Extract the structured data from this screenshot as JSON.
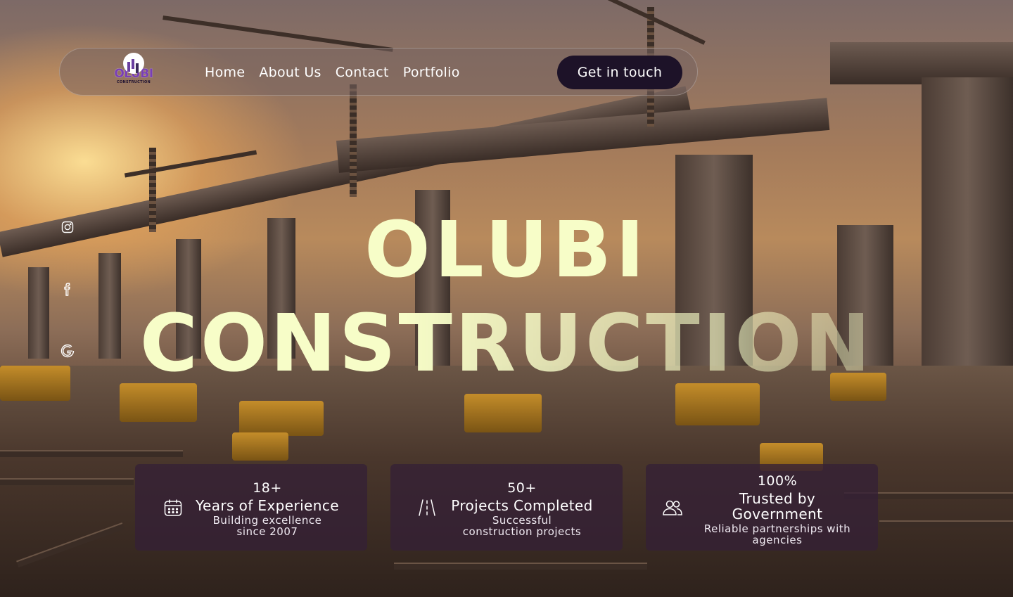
{
  "brand": {
    "logo_text": "OLUBI",
    "logo_subtext": "CONSTRUCTION"
  },
  "nav": {
    "links": [
      "Home",
      "About Us",
      "Contact",
      "Portfolio"
    ],
    "cta_label": "Get in touch"
  },
  "social": [
    "instagram-icon",
    "facebook-icon",
    "google-icon"
  ],
  "hero": {
    "line1": "OLUBI",
    "line2": "CONSTRUCTION"
  },
  "stats": [
    {
      "icon": "calendar-icon",
      "value": "18+",
      "title": "Years of Experience",
      "desc_line1": "Building excellence",
      "desc_line2": "since 2007"
    },
    {
      "icon": "road-icon",
      "value": "50+",
      "title": "Projects Completed",
      "desc_line1": "Successful",
      "desc_line2": "construction projects"
    },
    {
      "icon": "users-icon",
      "value": "100%",
      "title_line1": "Trusted by",
      "title_line2": "Government",
      "desc_line1": "Reliable partnerships with",
      "desc_line2": "agencies"
    }
  ],
  "colors": {
    "hero_text": "#f7fdc8",
    "cta_bg": "#1d1228",
    "card_bg": "#342036",
    "brand_purple": "#7a3fb5"
  }
}
